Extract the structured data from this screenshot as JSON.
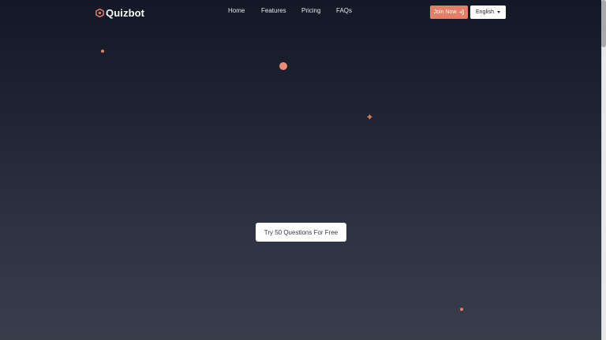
{
  "brand": {
    "name": "Quizbot",
    "icon": "hexagon-logo-icon",
    "accent_color": "#e57e67"
  },
  "nav": {
    "items": [
      {
        "label": "Home"
      },
      {
        "label": "Features"
      },
      {
        "label": "Pricing"
      },
      {
        "label": "FAQs"
      }
    ]
  },
  "header_actions": {
    "join_label": "Join Now",
    "join_icon": "login-arrow-icon",
    "language": {
      "selected": "English",
      "icon": "caret-down-icon"
    }
  },
  "hero": {
    "cta_label": "Try 50 Questions For Free"
  },
  "colors": {
    "background_top": "#121826",
    "background_bottom": "#383e4b",
    "accent": "#e57e67",
    "button_bg": "#ffffff"
  }
}
